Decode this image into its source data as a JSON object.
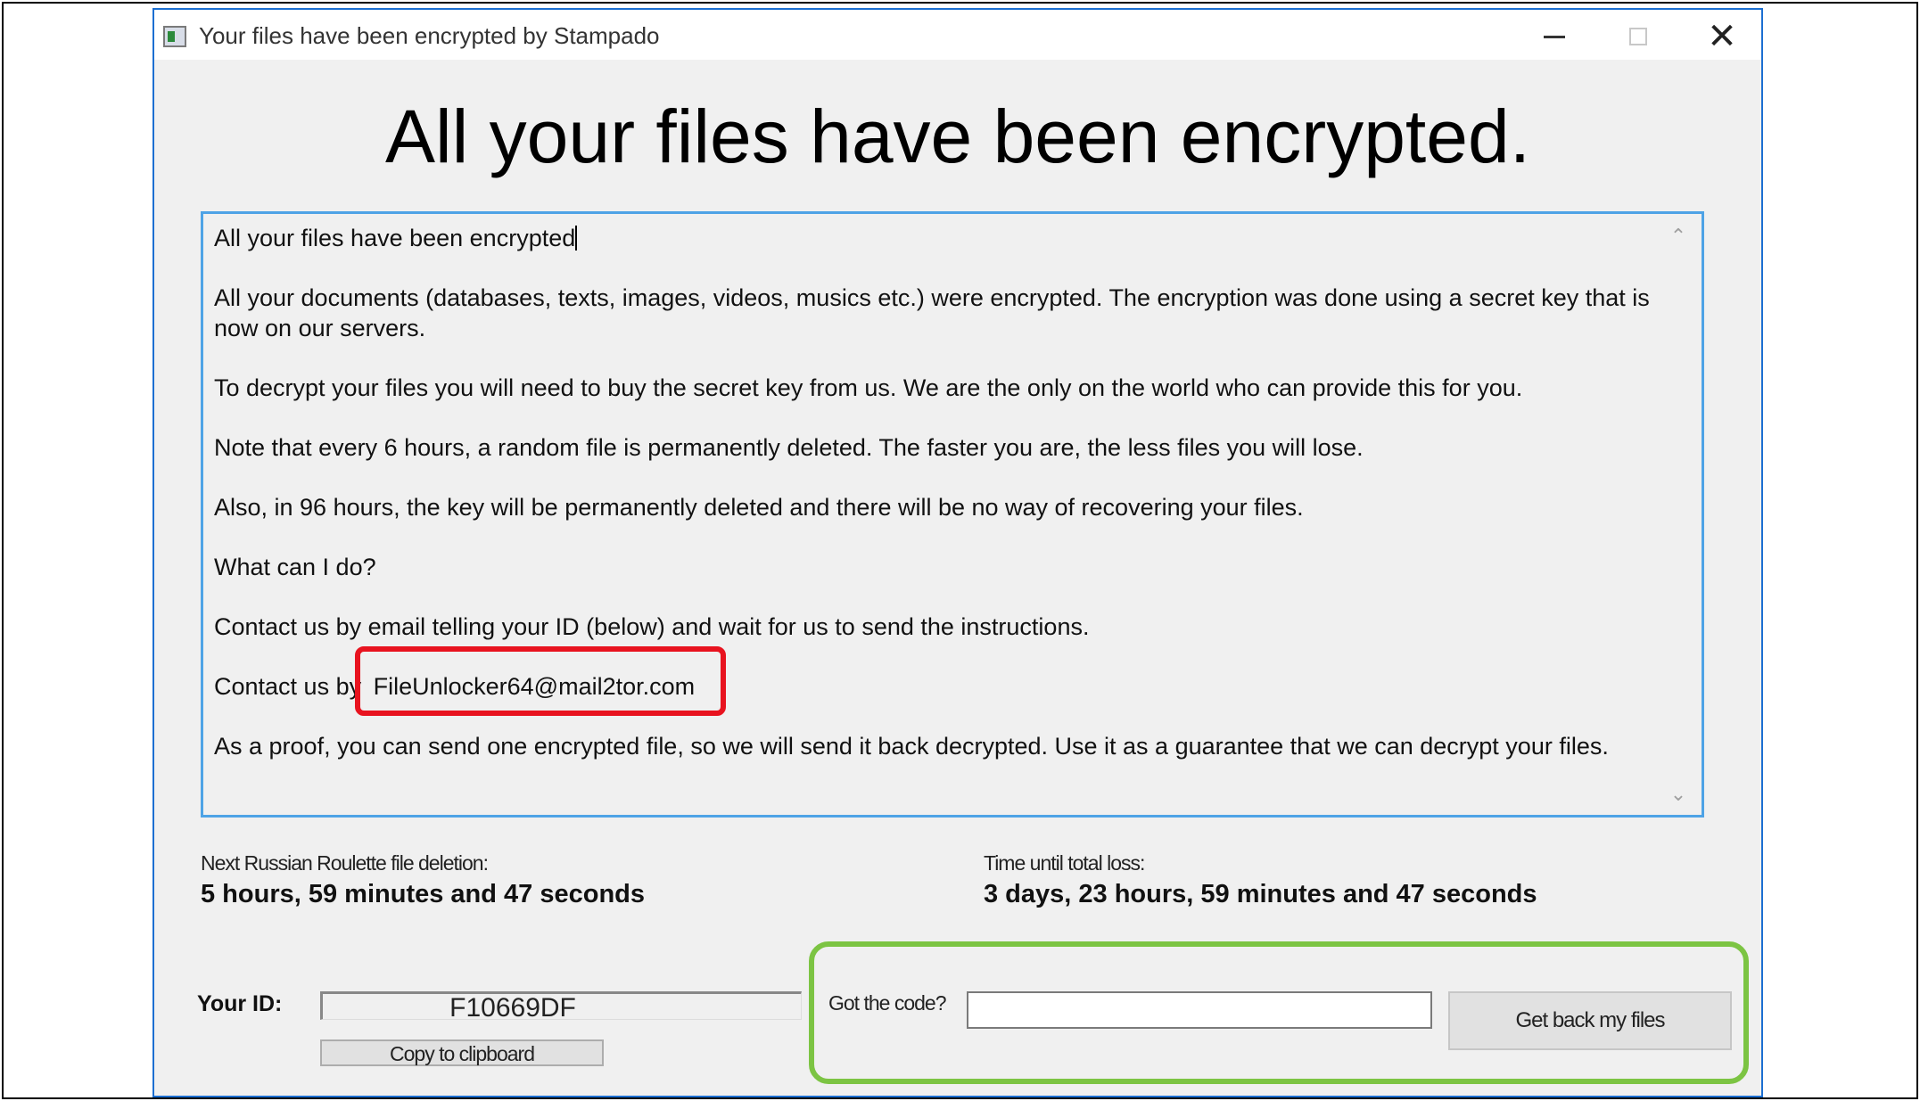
{
  "window": {
    "title": "Your files have been encrypted by Stampado",
    "minimize_icon": "minimize-icon",
    "maximize_icon": "maximize-icon",
    "close_icon": "close-icon",
    "close_glyph": "✕"
  },
  "headline": "All your files have been encrypted.",
  "message": {
    "line1": "All your files have been encrypted",
    "line2": "All your documents (databases, texts, images, videos, musics etc.) were encrypted. The encryption was done using a secret key that is now on our servers.",
    "line3": "To decrypt your files you will need to buy the secret key from us. We are the only on the world who can provide this for you.",
    "line4": "Note that every 6 hours, a random file is permanently deleted. The faster you are, the less files you will lose.",
    "line5": "Also, in 96 hours, the key will be permanently deleted and there will be no way of recovering your files.",
    "line6": "What can I do?",
    "line7": "Contact us by email telling your ID (below) and wait for us to send the instructions.",
    "contact_prefix": "Contact us by",
    "email": "FileUnlocker64@mail2tor.com",
    "line9": "As a proof, you can send one encrypted file, so we will send it back decrypted. Use it as a guarantee that we can decrypt your files.",
    "scroll_up_glyph": "⌃",
    "scroll_down_glyph": "⌄"
  },
  "timers": {
    "next_deletion_label": "Next Russian Roulette file deletion:",
    "next_deletion_value": "5 hours, 59 minutes and 47 seconds",
    "total_loss_label": "Time until total loss:",
    "total_loss_value": "3 days, 23 hours, 59 minutes and 47 seconds"
  },
  "id_section": {
    "label": "Your ID:",
    "value": "F10669DF",
    "copy_button": "Copy to clipboard"
  },
  "code_section": {
    "label": "Got the code?",
    "input_value": "",
    "submit_button": "Get back my files"
  },
  "colors": {
    "highlight_red": "#e8131f",
    "highlight_green": "#7cc443",
    "window_border": "#1c6fd1",
    "textbox_border": "#4ea3e6"
  }
}
